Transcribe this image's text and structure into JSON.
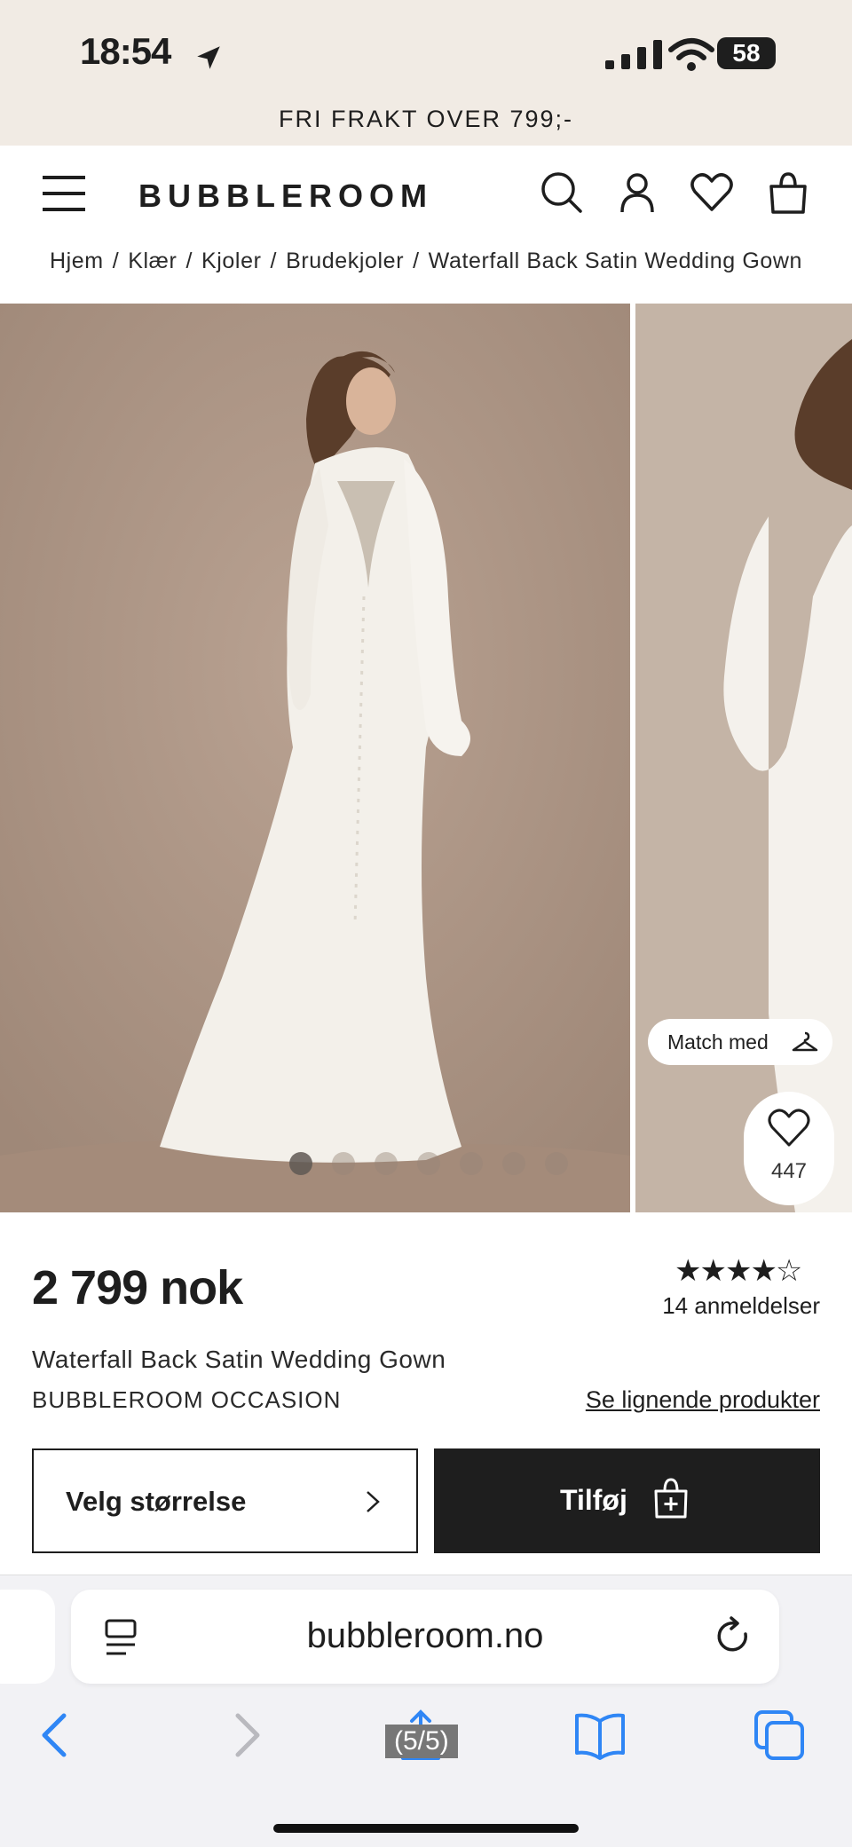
{
  "status_bar": {
    "time": "18:54",
    "battery": "58"
  },
  "promo": {
    "text": "FRI FRAKT OVER 799;-"
  },
  "header": {
    "logo": "BUBBLEROOM",
    "icons": [
      "menu-icon",
      "search-icon",
      "account-icon",
      "wishlist-icon",
      "bag-icon"
    ]
  },
  "breadcrumb": {
    "items": [
      "Hjem",
      "Klær",
      "Kjoler",
      "Brudekjoler",
      "Waterfall Back Satin Wedding Gown"
    ],
    "separator": "/"
  },
  "gallery": {
    "active_index": 0,
    "dot_count": 7,
    "match_label": "Match med",
    "favorite_count": "447"
  },
  "product": {
    "price": "2 799 nok",
    "rating": 4,
    "rating_max": 5,
    "stars": "★★★★☆",
    "reviews": "14 anmeldelser",
    "name": "Waterfall Back Satin Wedding Gown",
    "brand": "BUBBLEROOM OCCASION",
    "similar_link": "Se lignende produkter",
    "size_button": "Velg størrelse",
    "add_button": "Tilføj"
  },
  "browser": {
    "url": "bubbleroom.no",
    "page_counter": "(5/5)"
  },
  "colors": {
    "promo_bg": "#f1ebe4",
    "text": "#1e1e1e",
    "button_dark": "#1e1e1e",
    "photo_bg": "#ad9686",
    "browser_bg": "#f2f2f5",
    "link_blue": "#2f86f5"
  }
}
